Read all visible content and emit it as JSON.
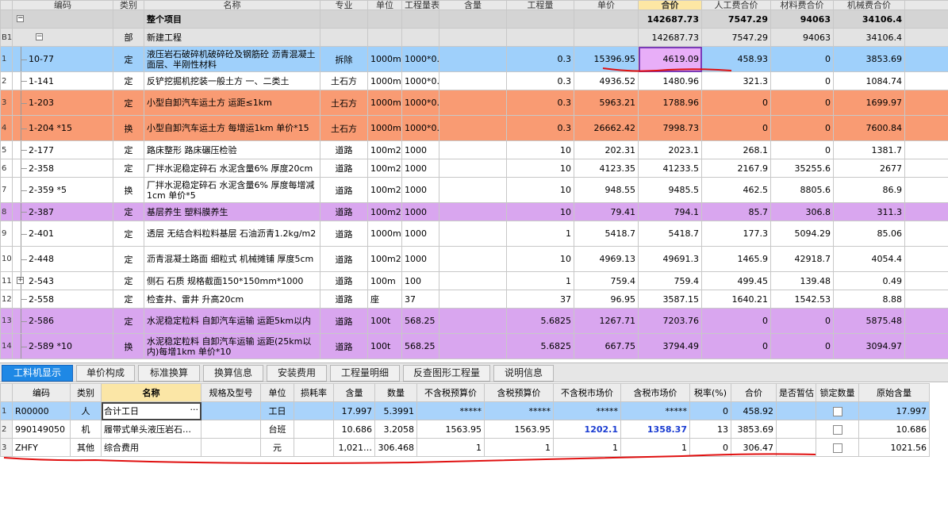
{
  "top_headers": [
    "编码",
    "类别",
    "名称",
    "专业",
    "单位",
    "工程量表达式",
    "含量",
    "工程量",
    "单价",
    "合价",
    "人工费合价",
    "材料费合价",
    "机械费合价"
  ],
  "total_row": {
    "row_num": "",
    "name": "整个项目",
    "total": "142687.73",
    "labor": "7547.29",
    "material": "94063",
    "machine": "34106.4"
  },
  "dept_row": {
    "row_num": "B1",
    "cat": "部",
    "name": "新建工程",
    "total": "142687.73",
    "labor": "7547.29",
    "material": "94063",
    "machine": "34106.4"
  },
  "rows": [
    {
      "row_num": "1",
      "code": "10-77",
      "cat": "定",
      "name": "液压岩石破碎机破碎砼及钢筋砼 沥青混凝土面层、半刚性材料",
      "major": "拆除",
      "unit": "1000m3",
      "expr": "1000*0.3",
      "content": "",
      "qty": "0.3",
      "price": "15396.95",
      "total": "4619.09",
      "labor": "458.93",
      "material": "0",
      "machine": "3853.69"
    },
    {
      "row_num": "2",
      "code": "1-141",
      "cat": "定",
      "name": "反铲挖掘机挖装一般土方 一、二类土",
      "major": "土石方",
      "unit": "1000m3",
      "expr": "1000*0.3",
      "content": "",
      "qty": "0.3",
      "price": "4936.52",
      "total": "1480.96",
      "labor": "321.3",
      "material": "0",
      "machine": "1084.74"
    },
    {
      "row_num": "3",
      "code": "1-203",
      "cat": "定",
      "name": "小型自卸汽车运土方 运距≤1km",
      "major": "土石方",
      "unit": "1000m3",
      "expr": "1000*0.3",
      "content": "",
      "qty": "0.3",
      "price": "5963.21",
      "total": "1788.96",
      "labor": "0",
      "material": "0",
      "machine": "1699.97"
    },
    {
      "row_num": "4",
      "code": "1-204 *15",
      "cat": "换",
      "name": "小型自卸汽车运土方 每增运1km 单价*15",
      "major": "土石方",
      "unit": "1000m3",
      "expr": "1000*0.3",
      "content": "",
      "qty": "0.3",
      "price": "26662.42",
      "total": "7998.73",
      "labor": "0",
      "material": "0",
      "machine": "7600.84"
    },
    {
      "row_num": "5",
      "code": "2-177",
      "cat": "定",
      "name": "路床整形 路床碾压检验",
      "major": "道路",
      "unit": "100m2",
      "expr": "1000",
      "content": "",
      "qty": "10",
      "price": "202.31",
      "total": "2023.1",
      "labor": "268.1",
      "material": "0",
      "machine": "1381.7"
    },
    {
      "row_num": "6",
      "code": "2-358",
      "cat": "定",
      "name": "厂拌水泥稳定碎石 水泥含量6% 厚度20cm",
      "major": "道路",
      "unit": "100m2",
      "expr": "1000",
      "content": "",
      "qty": "10",
      "price": "4123.35",
      "total": "41233.5",
      "labor": "2167.9",
      "material": "35255.6",
      "machine": "2677"
    },
    {
      "row_num": "7",
      "code": "2-359 *5",
      "cat": "换",
      "name": "厂拌水泥稳定碎石 水泥含量6% 厚度每增减1cm 单价*5",
      "major": "道路",
      "unit": "100m2",
      "expr": "1000",
      "content": "",
      "qty": "10",
      "price": "948.55",
      "total": "9485.5",
      "labor": "462.5",
      "material": "8805.6",
      "machine": "86.9"
    },
    {
      "row_num": "8",
      "code": "2-387",
      "cat": "定",
      "name": "基层养生 塑料膜养生",
      "major": "道路",
      "unit": "100m2",
      "expr": "1000",
      "content": "",
      "qty": "10",
      "price": "79.41",
      "total": "794.1",
      "labor": "85.7",
      "material": "306.8",
      "machine": "311.3"
    },
    {
      "row_num": "9",
      "code": "2-401",
      "cat": "定",
      "name": "透层 无结合料粒料基层 石油沥青1.2kg/m2",
      "major": "道路",
      "unit": "1000m2",
      "expr": "1000",
      "content": "",
      "qty": "1",
      "price": "5418.7",
      "total": "5418.7",
      "labor": "177.3",
      "material": "5094.29",
      "machine": "85.06"
    },
    {
      "row_num": "10",
      "code": "2-448",
      "cat": "定",
      "name": "沥青混凝土路面 细粒式 机械摊铺 厚度5cm",
      "major": "道路",
      "unit": "100m2",
      "expr": "1000",
      "content": "",
      "qty": "10",
      "price": "4969.13",
      "total": "49691.3",
      "labor": "1465.9",
      "material": "42918.7",
      "machine": "4054.4"
    },
    {
      "row_num": "11",
      "code": "2-543",
      "cat": "定",
      "name": "侧石 石质 规格截面150*150mm*1000",
      "major": "道路",
      "unit": "100m",
      "expr": "100",
      "content": "",
      "qty": "1",
      "price": "759.4",
      "total": "759.4",
      "labor": "499.45",
      "material": "139.48",
      "machine": "0.49"
    },
    {
      "row_num": "12",
      "code": "2-558",
      "cat": "定",
      "name": "检查井、雷井 升高20cm",
      "major": "道路",
      "unit": "座",
      "expr": "37",
      "content": "",
      "qty": "37",
      "price": "96.95",
      "total": "3587.15",
      "labor": "1640.21",
      "material": "1542.53",
      "machine": "8.88"
    },
    {
      "row_num": "13",
      "code": "2-586",
      "cat": "定",
      "name": "水泥稳定粒料 自卸汽车运输 运距5km以内",
      "major": "道路",
      "unit": "100t",
      "expr": "568.25",
      "content": "",
      "qty": "5.6825",
      "price": "1267.71",
      "total": "7203.76",
      "labor": "0",
      "material": "0",
      "machine": "5875.48"
    },
    {
      "row_num": "14",
      "code": "2-589 *10",
      "cat": "换",
      "name": "水泥稳定粒料 自卸汽车运输 运距(25km以内)每增1km 单价*10",
      "major": "道路",
      "unit": "100t",
      "expr": "568.25",
      "content": "",
      "qty": "5.6825",
      "price": "667.75",
      "total": "3794.49",
      "labor": "0",
      "material": "0",
      "machine": "3094.97"
    }
  ],
  "tabs": [
    "工料机显示",
    "单价构成",
    "标准换算",
    "换算信息",
    "安装费用",
    "工程量明细",
    "反查图形工程量",
    "说明信息"
  ],
  "bottom_headers": [
    "编码",
    "类别",
    "名称",
    "规格及型号",
    "单位",
    "损耗率",
    "含量",
    "数量",
    "不含税预算价",
    "含税预算价",
    "不含税市场价",
    "含税市场价",
    "税率(%)",
    "合价",
    "是否暂估",
    "锁定数量",
    "原始含量"
  ],
  "bottom_rows": [
    {
      "row_num": "1",
      "code": "R00000",
      "cat": "人",
      "name": "合计工日",
      "spec": "",
      "unit": "工日",
      "loss": "",
      "content": "17.997",
      "qty": "5.3991",
      "pre_ex": "*****",
      "pre_in": "*****",
      "mkt_ex": "*****",
      "mkt_in": "*****",
      "tax": "0",
      "total": "458.92",
      "est": "",
      "orig": "17.997"
    },
    {
      "row_num": "2",
      "code": "990149050",
      "cat": "机",
      "name": "履带式单头液压岩石…",
      "spec": "",
      "unit": "台班",
      "loss": "",
      "content": "10.686",
      "qty": "3.2058",
      "pre_ex": "1563.95",
      "pre_in": "1563.95",
      "mkt_ex": "1202.1",
      "mkt_in": "1358.37",
      "tax": "13",
      "total": "3853.69",
      "est": "",
      "orig": "10.686"
    },
    {
      "row_num": "3",
      "code": "ZHFY",
      "cat": "其他",
      "name": "综合费用",
      "spec": "",
      "unit": "元",
      "loss": "",
      "content": "1,021…",
      "qty": "306.468",
      "pre_ex": "1",
      "pre_in": "1",
      "mkt_ex": "1",
      "mkt_in": "1",
      "tax": "0",
      "total": "306.47",
      "est": "",
      "orig": "1021.56"
    }
  ],
  "colors": {
    "selected_row": "#9fd0fb",
    "orange_row": "#f99b73",
    "purple_row": "#d9a6ef",
    "active_tab": "#1e88e5",
    "annotation": "#e01010"
  }
}
